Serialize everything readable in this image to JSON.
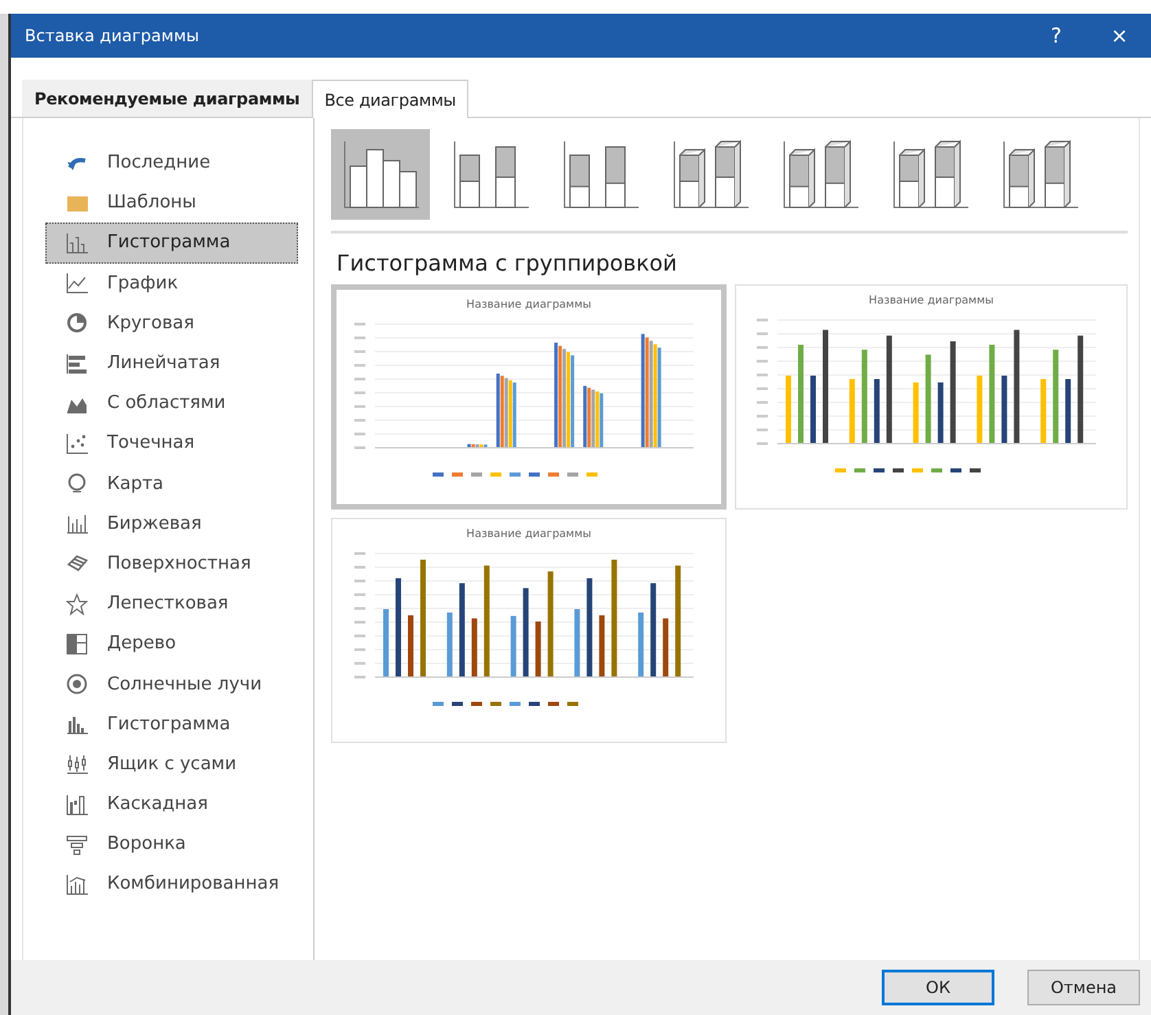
{
  "window": {
    "title": "Вставка диаграммы",
    "help": "?",
    "close": "×"
  },
  "tabs": [
    {
      "label": "Рекомендуемые диаграммы",
      "selected": false
    },
    {
      "label": "Все диаграммы",
      "selected": true
    }
  ],
  "sidebar": {
    "items": [
      {
        "label": "Последние",
        "selected": false
      },
      {
        "label": "Шаблоны",
        "selected": false
      },
      {
        "label": "Гистограмма",
        "selected": true
      },
      {
        "label": "График",
        "selected": false
      },
      {
        "label": "Круговая",
        "selected": false
      },
      {
        "label": "Линейчатая",
        "selected": false
      },
      {
        "label": "С областями",
        "selected": false
      },
      {
        "label": "Точечная",
        "selected": false
      },
      {
        "label": "Карта",
        "selected": false
      },
      {
        "label": "Биржевая",
        "selected": false
      },
      {
        "label": "Поверхностная",
        "selected": false
      },
      {
        "label": "Лепестковая",
        "selected": false
      },
      {
        "label": "Дерево",
        "selected": false
      },
      {
        "label": "Солнечные лучи",
        "selected": false
      },
      {
        "label": "Гистограмма",
        "selected": false
      },
      {
        "label": "Ящик с усами",
        "selected": false
      },
      {
        "label": "Каскадная",
        "selected": false
      },
      {
        "label": "Воронка",
        "selected": false
      },
      {
        "label": "Комбинированная",
        "selected": false
      }
    ]
  },
  "subtypes": [
    {
      "selected": true
    },
    {
      "selected": false
    },
    {
      "selected": false
    },
    {
      "selected": false
    },
    {
      "selected": false
    },
    {
      "selected": false
    },
    {
      "selected": false
    }
  ],
  "subtype_title": "Гистограмма с группировкой",
  "previews": [
    {
      "title": "Название диаграммы",
      "selected": true
    },
    {
      "title": "Название диаграммы",
      "selected": false
    },
    {
      "title": "Название диаграммы",
      "selected": false
    }
  ],
  "buttons": [
    {
      "label": "ОК",
      "kind": "default"
    },
    {
      "label": "Отмена",
      "kind": "normal"
    }
  ]
}
